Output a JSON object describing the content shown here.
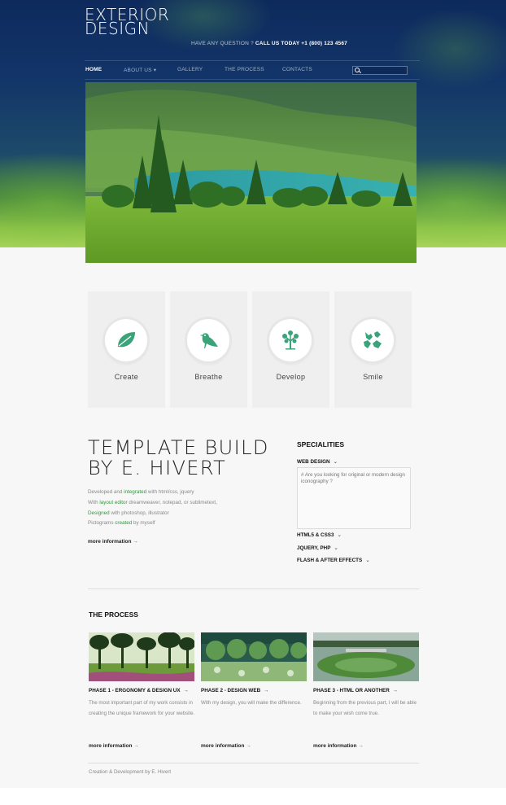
{
  "header": {
    "logo_line1": "EXTERIOR",
    "logo_line2": "DESIGN",
    "question": "HAVE ANY QUESTION ?",
    "call": "CALL US TODAY +1 (800) 123 4567"
  },
  "nav": {
    "items": [
      {
        "label": "HOME",
        "active": true
      },
      {
        "label": "ABOUT US ▾",
        "active": false
      },
      {
        "label": "GALLERY",
        "active": false
      },
      {
        "label": "THE PROCESS",
        "active": false
      },
      {
        "label": "CONTACTS",
        "active": false
      }
    ],
    "search_placeholder": ""
  },
  "features": [
    {
      "label": "Create",
      "icon": "leaf-icon"
    },
    {
      "label": "Breathe",
      "icon": "bird-icon"
    },
    {
      "label": "Develop",
      "icon": "tree-icon"
    },
    {
      "label": "Smile",
      "icon": "hands-icon"
    }
  ],
  "about": {
    "title_line1": "TEMPLATE BUILD",
    "title_line2": "BY E. HIVERT",
    "line1_pre": "Developed and ",
    "line1_hl": "integrated",
    "line1_post": " with html/css, jquery",
    "line2_pre": "With ",
    "line2_hl": "layout editor",
    "line2_post": " dreamweaver, notepad, or sublimetext,",
    "line3_hl": "Designed",
    "line3_post": " with photoshop, illustrator",
    "line4_pre": "Pictograms ",
    "line4_hl": "created",
    "line4_post": " by myself",
    "more": "more information"
  },
  "specialities": {
    "title": "SPECIALITIES",
    "items": [
      {
        "label": "WEB DESIGN",
        "chevron": "⌄"
      },
      {
        "label": "HTML5 & CSS3",
        "chevron": "⌄"
      },
      {
        "label": "JQUERY, PHP",
        "chevron": "⌄"
      },
      {
        "label": "FLASH & AFTER EFFECTS",
        "chevron": "⌄"
      }
    ],
    "panel_text": "# Are you looking for original or modern design iconography ?"
  },
  "process": {
    "title": "THE PROCESS",
    "phases": [
      {
        "title": "PHASE 1 - ERGONOMY & DESIGN UX",
        "arrow": "→",
        "text": "The most important part of my work consists in creating the unique framework for your website.",
        "more": "more information"
      },
      {
        "title": "PHASE 2 - DESIGN WEB",
        "arrow": "→",
        "text": "With my design, you will make the difference.",
        "more": "more information"
      },
      {
        "title": "PHASE 3 - HTML OR ANOTHER",
        "arrow": "→",
        "text": "Beginning from the previous part, I will be able to make your wish come true.",
        "more": "more information"
      }
    ]
  },
  "footer": {
    "text": "Creation & Development by E. Hivert"
  },
  "colors": {
    "accent": "#2e9a3a",
    "icon": "#3aa37a",
    "header_dark": "#0e2a5c"
  }
}
